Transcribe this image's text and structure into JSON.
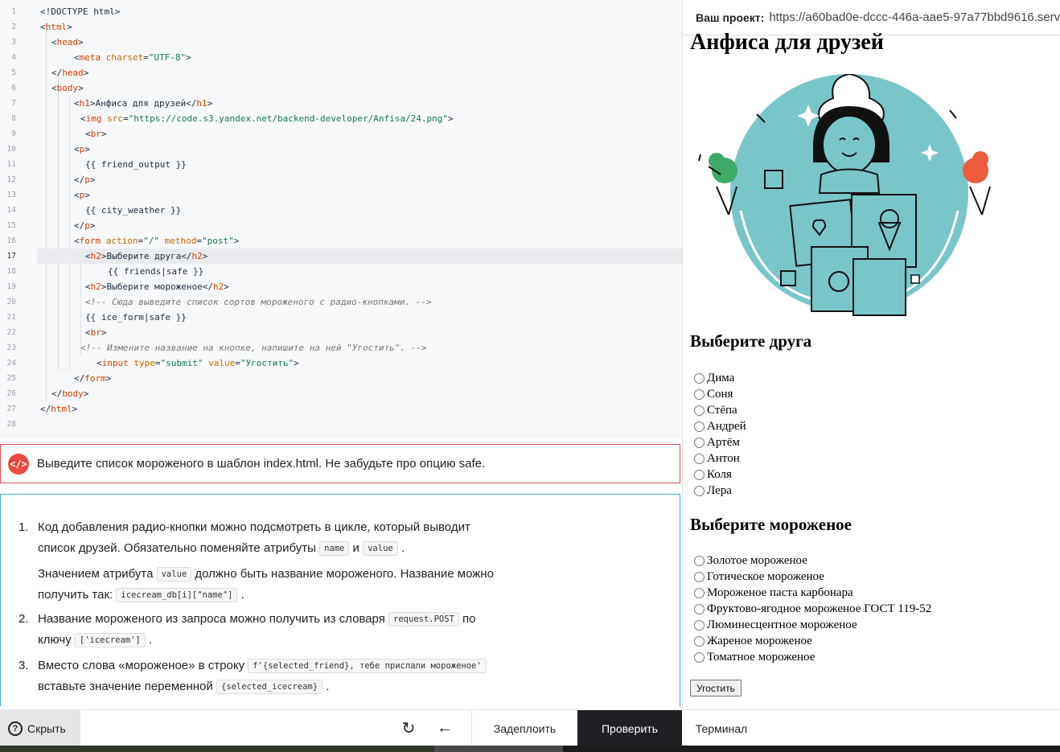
{
  "editor": {
    "line_numbers": [
      "1",
      "2",
      "3",
      "4",
      "5",
      "6",
      "7",
      "8",
      "9",
      "10",
      "11",
      "12",
      "13",
      "14",
      "15",
      "16",
      "17",
      "18",
      "19",
      "20",
      "21",
      "22",
      "23",
      "24",
      "25",
      "26",
      "27",
      "28"
    ],
    "lines": [
      [
        "<!DOCTYPE html>"
      ],
      [
        "<",
        "html",
        ">"
      ],
      [
        "<",
        "head",
        ">"
      ],
      [
        "<",
        "meta",
        " ",
        "charset",
        "=",
        "\"UTF-8\"",
        ">"
      ],
      [
        "</",
        "head",
        ">"
      ],
      [
        "<",
        "body",
        ">"
      ],
      [
        "<",
        "h1",
        ">Анфиса для друзей</",
        "h1",
        ">"
      ],
      [
        "<",
        "img",
        " ",
        "src",
        "=",
        "\"https://code.s3.yandex.net/backend-developer/Anfisa/24.png\"",
        ">"
      ],
      [
        "<",
        "br",
        ">"
      ],
      [
        "<",
        "p",
        ">"
      ],
      [
        "{{ friend_output }}"
      ],
      [
        "</",
        "p",
        ">"
      ],
      [
        "<",
        "p",
        ">"
      ],
      [
        "{{ city_weather }}"
      ],
      [
        "</",
        "p",
        ">"
      ],
      [
        "<",
        "form",
        " ",
        "action",
        "=",
        "\"/\"",
        " ",
        "method",
        "=",
        "\"post\"",
        ">"
      ],
      [
        "<",
        "h2",
        ">Выберите друга</",
        "h2",
        ">"
      ],
      [
        "{{ friends|safe }}"
      ],
      [
        "<",
        "h2",
        ">Выберите мороженое</",
        "h2",
        ">"
      ],
      [
        "<!-- Сюда выведите список сортов мороженого с радио-кнопками. -->"
      ],
      [
        "{{ ice_form|safe }}"
      ],
      [
        "<",
        "br",
        ">"
      ],
      [
        "<!-- Измените название на кнопке, напишите на ней \"Угостить\". -->"
      ],
      [
        "<",
        "input",
        " ",
        "type",
        "=",
        "\"submit\"",
        " ",
        "value",
        "=",
        "\"Угостить\"",
        ">"
      ],
      [
        "</",
        "form",
        ">"
      ],
      [
        "</",
        "body",
        ">"
      ],
      [
        "</",
        "html",
        ">"
      ],
      [
        ""
      ]
    ]
  },
  "error": {
    "icon": "code-icon",
    "icon_glyph": "</>",
    "message": "Выведите список мороженого в шаблон index.html. Не забудьте про опцию safe."
  },
  "hints": [
    {
      "number": "1.",
      "parts": [
        [
          "text",
          "Код добавления радио-кнопки можно подсмотреть в цикле, который выводит список друзей. Обязательно поменяйте атрибуты "
        ],
        [
          "code",
          "name"
        ],
        [
          "text",
          " и "
        ],
        [
          "code",
          "value"
        ],
        [
          "text",
          " ."
        ],
        [
          "break",
          ""
        ],
        [
          "text",
          "Значением атрибута "
        ],
        [
          "code",
          "value"
        ],
        [
          "text",
          " должно быть название мороженого. Название можно получить так: "
        ],
        [
          "code",
          "icecream_db[i][\"name\"]"
        ],
        [
          "text",
          " ."
        ]
      ]
    },
    {
      "number": "2.",
      "parts": [
        [
          "text",
          "Название мороженого из запроса можно получить из словаря "
        ],
        [
          "code",
          "request.POST"
        ],
        [
          "text",
          " по ключу "
        ],
        [
          "code",
          "['icecream']"
        ],
        [
          "text",
          " ."
        ]
      ]
    },
    {
      "number": "3.",
      "parts": [
        [
          "text",
          "Вместо слова «мороженое» в строку "
        ],
        [
          "code",
          "f'{selected_friend}, тебе прислали мороженое'"
        ],
        [
          "text",
          " вставьте значение переменной "
        ],
        [
          "code",
          "{selected_icecream}"
        ],
        [
          "text",
          " ."
        ]
      ]
    }
  ],
  "toolbar": {
    "hide_label": "Скрыть",
    "hide_icon": "help-icon",
    "undo_icon": "refresh-icon",
    "back_icon": "arrow-left-icon",
    "deploy_label": "Задеплоить",
    "check_label": "Проверить",
    "terminal_label": "Терминал"
  },
  "preview": {
    "project_label": "Ваш проект:",
    "project_url": "https://a60bad0e-dccc-446a-aae5-97a77bbd9616.serv",
    "h1": "Анфиса для друзей",
    "image": "anfisa-illustration",
    "friends_title": "Выберите друга",
    "friends": [
      "Дима",
      "Соня",
      "Стёпа",
      "Андрей",
      "Артём",
      "Антон",
      "Коля",
      "Лера"
    ],
    "icecream_title": "Выберите мороженое",
    "icecreams": [
      "Золотое мороженое",
      "Готическое мороженое",
      "Мороженое паста карбонара",
      "Фруктово-ягодное мороженое ГОСТ 119-52",
      "Люминесцентное мороженое",
      "Жареное мороженое",
      "Томатное мороженое"
    ],
    "submit_label": "Угостить"
  },
  "colors": {
    "accent_teal": "#79c6c8",
    "error_red": "#e84a3d",
    "check_button_bg": "#1d1f22",
    "hint_border": "#4aa3df"
  }
}
